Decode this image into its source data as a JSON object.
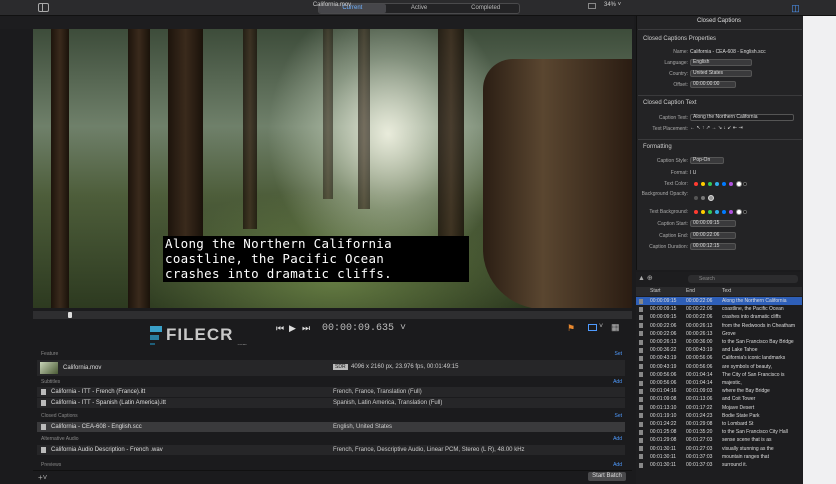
{
  "tabs": [
    {
      "label": "Current",
      "selected": true
    },
    {
      "label": "Active",
      "selected": false
    },
    {
      "label": "Completed",
      "selected": false
    }
  ],
  "viewer": {
    "title": "California.mov",
    "zoom": "34% ˅",
    "timecode": "00:00:09.635 ˅",
    "caption_lines": [
      "Along the Northern California",
      "coastline, the Pacific Ocean",
      "crashes into dramatic cliffs."
    ]
  },
  "watermark": {
    "text": "FILECR",
    "sub": ".com"
  },
  "attachments": {
    "feature": {
      "label": "Feature",
      "action": "Set",
      "file": "California.mov",
      "badge": "SDR",
      "meta": "4096 x 2160 px, 23.976 fps, 00:01:49:15"
    },
    "subtitles": {
      "label": "Subtitles",
      "action": "Add",
      "rows": [
        {
          "file": "California - ITT - French (France).itt",
          "desc": "French, France, Translation (Full)"
        },
        {
          "file": "California - ITT - Spanish (Latin America).itt",
          "desc": "Spanish, Latin America, Translation (Full)"
        }
      ]
    },
    "closed_captions": {
      "label": "Closed Captions",
      "action": "Set",
      "rows": [
        {
          "file": "California - CEA-608 - English.scc",
          "desc": "English, United States"
        }
      ]
    },
    "alt_audio": {
      "label": "Alternative Audio",
      "action": "Add",
      "rows": [
        {
          "file": "California Audio Description - French .wav",
          "desc": "French, France, Descriptive Audio, Linear PCM, Stereo (L R), 48.00 kHz"
        }
      ]
    },
    "previews": {
      "label": "Previews",
      "action": "Add"
    },
    "start_batch": "Start Batch"
  },
  "inspector": {
    "title": "Closed Captions",
    "props_header": "Closed Captions Properties",
    "name_label": "Name:",
    "name_value": "California - CEA-608 - English.scc",
    "language_label": "Language:",
    "language_value": "English",
    "country_label": "Country:",
    "country_value": "United States",
    "offset_label": "Offset:",
    "offset_value": "00:00:00:00",
    "text_header": "Closed Caption Text",
    "caption_text_label": "Caption Text:",
    "caption_text_value": "Along the Northern California",
    "placement_label": "Text Placement:",
    "placement_glyphs": "← ↖ ↑ ↗ → ↘ ↓ ↙ ⇤ ⇥",
    "formatting_header": "Formatting",
    "style_label": "Caption Style:",
    "style_value": "Pop-On",
    "format_label": "Format:",
    "format_value": "I   U",
    "text_color_label": "Text Color:",
    "bg_opacity_label": "Background Opacity:",
    "text_bg_label": "Text Background:",
    "start_label": "Caption Start:",
    "start_value": "00:00:09:15",
    "end_label": "Caption End:",
    "end_value": "00:00:22:06",
    "duration_label": "Caption Duration:",
    "duration_value": "00:00:12:15",
    "palette": [
      "#ff3b30",
      "#ffcc00",
      "#34c759",
      "#32ade6",
      "#007aff",
      "#af52de",
      "#ffffff",
      "#000000"
    ]
  },
  "caption_list": {
    "search_placeholder": "Search",
    "headers": [
      "Start",
      "End",
      "Text"
    ],
    "rows": [
      [
        "00:00:09:15",
        "00:00:22:06",
        "Along the Northern California"
      ],
      [
        "00:00:09:15",
        "00:00:22:06",
        "coastline, the Pacific Ocean"
      ],
      [
        "00:00:09:15",
        "00:00:22:06",
        "crashes into dramatic cliffs"
      ],
      [
        "00:00:22:06",
        "00:00:26:13",
        "from the Redwoods in Cheatham"
      ],
      [
        "00:00:22:06",
        "00:00:26:13",
        "Grove"
      ],
      [
        "00:00:26:13",
        "00:00:36:00",
        "to the San Francisco Bay Bridge"
      ],
      [
        "00:00:36:22",
        "00:00:43:19",
        "and Lake Tahoe"
      ],
      [
        "00:00:43:19",
        "00:00:56:06",
        "California's iconic landmarks"
      ],
      [
        "00:00:43:19",
        "00:00:56:06",
        "are symbols of beauty,"
      ],
      [
        "00:00:56:06",
        "00:01:04:14",
        "The City of San Francisco is"
      ],
      [
        "00:00:56:06",
        "00:01:04:14",
        "majestic,"
      ],
      [
        "00:01:04:16",
        "00:01:09:03",
        "where the Bay Bridge"
      ],
      [
        "00:01:09:08",
        "00:01:13:06",
        "and Coit Tower"
      ],
      [
        "00:01:13:10",
        "00:01:17:22",
        "Mojave Desert"
      ],
      [
        "00:01:19:10",
        "00:01:24:23",
        "Bodie State Park"
      ],
      [
        "00:01:24:22",
        "00:01:29:08",
        "to Lombard St"
      ],
      [
        "00:01:25:08",
        "00:01:35:20",
        "to the San Francisco City Hall"
      ],
      [
        "00:01:29:08",
        "00:01:27:03",
        "sense scene that is as"
      ],
      [
        "00:01:30:11",
        "00:01:27:03",
        "visually stunning as the"
      ],
      [
        "00:01:30:11",
        "00:01:37:03",
        "mountain ranges that"
      ],
      [
        "00:01:30:11",
        "00:01:37:03",
        "surround it."
      ]
    ]
  }
}
